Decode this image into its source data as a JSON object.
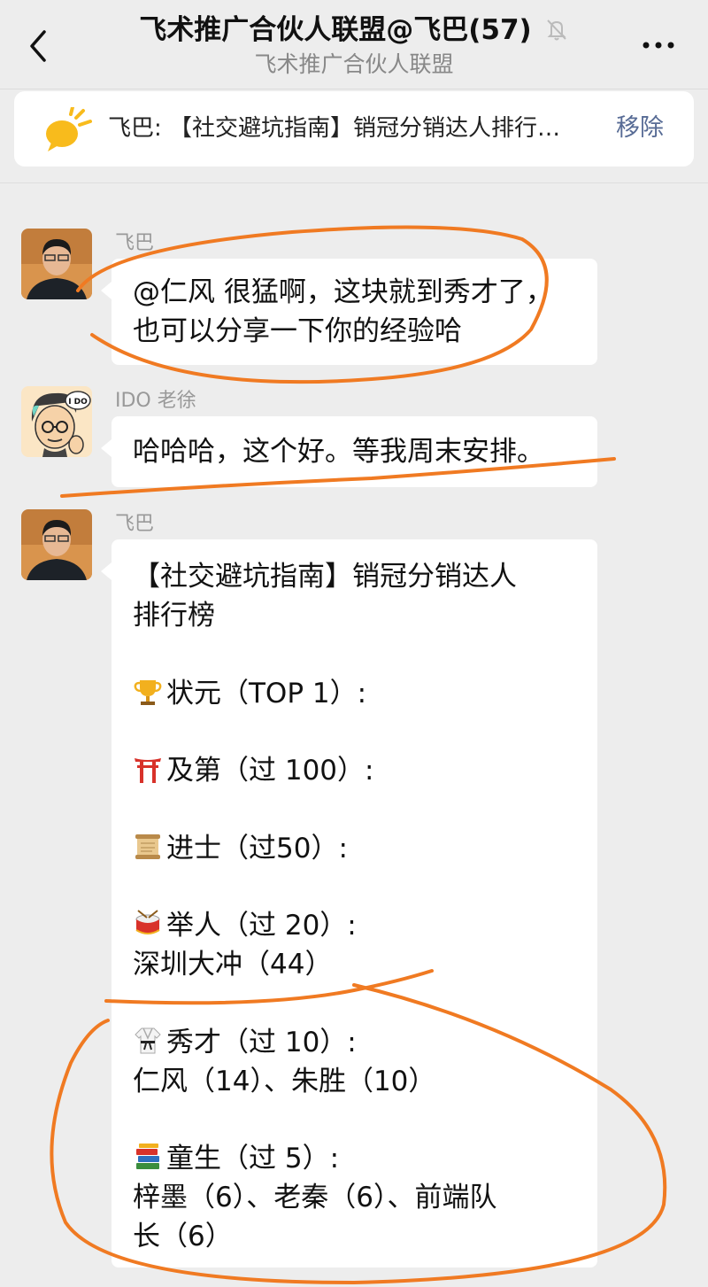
{
  "header": {
    "title": "飞术推广合伙人联盟@飞巴(57)",
    "subtitle": "飞术推广合伙人联盟"
  },
  "pinned": {
    "text": "飞巴: 【社交避坑指南】销冠分销达人排行…",
    "remove_label": "移除"
  },
  "messages": [
    {
      "sender": "飞巴",
      "lines": [
        "@仁风 很猛啊，这块就到秀才了，",
        "也可以分享一下你的经验哈"
      ]
    },
    {
      "sender": "IDO 老徐",
      "lines": [
        "哈哈哈，这个好。等我周末安排。"
      ]
    },
    {
      "sender": "飞巴",
      "lines": [
        "【社交避坑指南】销冠分销达人",
        "排行榜",
        "状元（TOP 1）:",
        "及第（过 100）:",
        "进士（过50）:",
        "举人（过 20）:",
        "深圳大冲（44）",
        "秀才（过 10）:",
        "仁风（14）、朱胜（10）",
        "童生（过 5）:",
        "梓墨（6）、老秦（6）、前端队",
        "长（6）"
      ]
    }
  ],
  "avatar_text": "I DO",
  "icons": [
    "back-icon",
    "mute-bell-icon",
    "more-icon",
    "megaphone-icon",
    "trophy-emoji",
    "torii-emoji",
    "scroll-emoji",
    "drum-emoji",
    "martial-arts-uniform-emoji",
    "books-emoji"
  ],
  "colors": {
    "background": "#ededed",
    "bubble": "#ffffff",
    "link": "#576b95",
    "annotation": "#f07a22"
  }
}
